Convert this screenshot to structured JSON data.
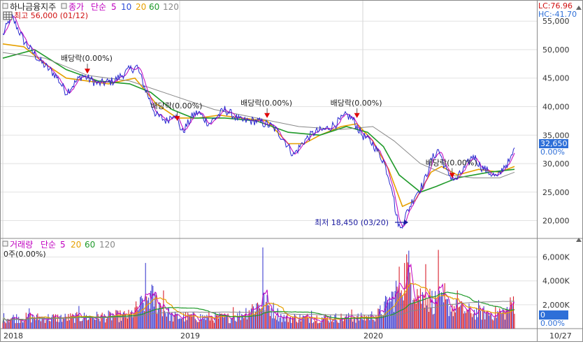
{
  "price_panel": {
    "legend": {
      "stock_name": "하나금융지주",
      "price_label": "종가",
      "ma_label": "단순",
      "periods": [
        "5",
        "10",
        "20",
        "60",
        "120"
      ]
    },
    "high_label": "최고 56,000 (01/12)",
    "low_label": "최저 18,450 (03/20)",
    "lc_label": "LC:76.96",
    "hc_label": "HC:-41.70",
    "current_price": "32,650",
    "current_change": "0.00%"
  },
  "volume_panel": {
    "legend": {
      "name": "거래량",
      "ma_label": "단순",
      "periods": [
        "5",
        "20",
        "60",
        "120"
      ]
    },
    "sub_label": "0주(0.00%)",
    "current_value": "0",
    "current_change": "0.00%"
  },
  "x_axis": {
    "labels": [
      "2018",
      "2019",
      "2020",
      "10/27"
    ]
  },
  "colors": {
    "price_line": "#2a2ad0",
    "ma5": "#c000c0",
    "ma10": "#2b4bd8",
    "ma20": "#e6a000",
    "ma60": "#1f9a2a",
    "ma120": "#888888",
    "dividend_marker": "#e00000",
    "volume_up": "#d8202c",
    "volume_down": "#3e3ed0",
    "accent_blue": "#2e6fd8"
  },
  "chart_data": [
    {
      "type": "line",
      "title": "하나금융지주",
      "x_unit": "trading days from 2018-01-02",
      "y_axis": {
        "range": [
          17000,
          56500
        ],
        "ticks": [
          "20,000",
          "25,000",
          "30,000",
          "35,000",
          "40,000",
          "45,000",
          "50,000",
          "55,000"
        ]
      },
      "x_axis_labels": [
        "2018",
        "2019",
        "2020",
        "10/27"
      ],
      "series": [
        {
          "name": "종가",
          "points": [
            [
              0,
              52500
            ],
            [
              8,
              56000
            ],
            [
              20,
              51500
            ],
            [
              35,
              48000
            ],
            [
              50,
              45500
            ],
            [
              60,
              42500
            ],
            [
              75,
              45500
            ],
            [
              90,
              44000
            ],
            [
              105,
              44500
            ],
            [
              120,
              46500
            ],
            [
              127,
              47000
            ],
            [
              135,
              43000
            ],
            [
              145,
              38500
            ],
            [
              155,
              37500
            ],
            [
              162,
              39000
            ],
            [
              170,
              35500
            ],
            [
              180,
              38500
            ],
            [
              185,
              39000
            ],
            [
              195,
              37000
            ],
            [
              210,
              39500
            ],
            [
              225,
              37500
            ],
            [
              240,
              37500
            ],
            [
              255,
              36500
            ],
            [
              265,
              34500
            ],
            [
              275,
              31500
            ],
            [
              285,
              34000
            ],
            [
              295,
              35500
            ],
            [
              305,
              36000
            ],
            [
              315,
              37000
            ],
            [
              325,
              38500
            ],
            [
              330,
              38000
            ],
            [
              340,
              35000
            ],
            [
              350,
              33500
            ],
            [
              360,
              30500
            ],
            [
              368,
              26000
            ],
            [
              372,
              21000
            ],
            [
              376,
              18450
            ],
            [
              380,
              20500
            ],
            [
              390,
              24500
            ],
            [
              398,
              26500
            ],
            [
              405,
              30500
            ],
            [
              412,
              32500
            ],
            [
              420,
              28500
            ],
            [
              428,
              27000
            ],
            [
              438,
              29500
            ],
            [
              445,
              31500
            ],
            [
              452,
              29500
            ],
            [
              460,
              28500
            ],
            [
              468,
              27500
            ],
            [
              474,
              29500
            ],
            [
              480,
              30500
            ],
            [
              484,
              32650
            ]
          ]
        },
        {
          "name": "20",
          "points": [
            [
              0,
              51000
            ],
            [
              20,
              50500
            ],
            [
              40,
              47500
            ],
            [
              60,
              45000
            ],
            [
              80,
              44500
            ],
            [
              100,
              44000
            ],
            [
              125,
              45000
            ],
            [
              145,
              40500
            ],
            [
              165,
              38000
            ],
            [
              185,
              38000
            ],
            [
              205,
              38500
            ],
            [
              225,
              38000
            ],
            [
              250,
              37500
            ],
            [
              270,
              33500
            ],
            [
              285,
              33500
            ],
            [
              300,
              35000
            ],
            [
              320,
              36500
            ],
            [
              335,
              37000
            ],
            [
              350,
              34000
            ],
            [
              365,
              29000
            ],
            [
              378,
              22500
            ],
            [
              390,
              23500
            ],
            [
              405,
              28500
            ],
            [
              415,
              29500
            ],
            [
              430,
              28000
            ],
            [
              450,
              29000
            ],
            [
              470,
              28500
            ],
            [
              484,
              29500
            ]
          ]
        },
        {
          "name": "60",
          "points": [
            [
              0,
              48500
            ],
            [
              30,
              50000
            ],
            [
              60,
              46500
            ],
            [
              90,
              44500
            ],
            [
              120,
              44000
            ],
            [
              140,
              42500
            ],
            [
              160,
              39500
            ],
            [
              180,
              38000
            ],
            [
              210,
              38000
            ],
            [
              240,
              37500
            ],
            [
              270,
              35500
            ],
            [
              300,
              35000
            ],
            [
              325,
              36500
            ],
            [
              345,
              35500
            ],
            [
              360,
              33000
            ],
            [
              375,
              28000
            ],
            [
              395,
              25000
            ],
            [
              410,
              26000
            ],
            [
              430,
              27500
            ],
            [
              460,
              28500
            ],
            [
              484,
              29000
            ]
          ]
        },
        {
          "name": "120",
          "points": [
            [
              0,
              49500
            ],
            [
              40,
              48500
            ],
            [
              80,
              45500
            ],
            [
              120,
              44500
            ],
            [
              160,
              42000
            ],
            [
              200,
              39500
            ],
            [
              240,
              38000
            ],
            [
              280,
              36500
            ],
            [
              320,
              36000
            ],
            [
              350,
              36500
            ],
            [
              370,
              34000
            ],
            [
              395,
              30000
            ],
            [
              420,
              28000
            ],
            [
              445,
              27500
            ],
            [
              470,
              27500
            ],
            [
              484,
              28500
            ]
          ]
        }
      ],
      "annotations": [
        {
          "label": "최고 56,000 (01/12)",
          "x": 8,
          "y": 56000
        },
        {
          "label": "최저 18,450 (03/20)",
          "x": 376,
          "y": 18450
        },
        {
          "label": "배당락(0.00%)",
          "x": 80,
          "y": 45800
        },
        {
          "label": "배당락(0.00%)",
          "x": 165,
          "y": 37500
        },
        {
          "label": "배당락(0.00%)",
          "x": 250,
          "y": 38000
        },
        {
          "label": "배당락(0.00%)",
          "x": 335,
          "y": 38000
        },
        {
          "label": "배당락(0.00%)",
          "x": 425,
          "y": 27500
        }
      ],
      "current": {
        "value": 32650,
        "label": "32,650",
        "change": "0.00%"
      }
    },
    {
      "type": "bar",
      "title": "거래량",
      "x_unit": "trading days from 2018-01-02",
      "y_axis": {
        "range": [
          0,
          7500000
        ],
        "ticks": [
          "2,000K",
          "4,000K",
          "6,000K"
        ]
      },
      "volume_shape_points": [
        [
          0,
          1000000
        ],
        [
          60,
          1000000
        ],
        [
          120,
          1200000
        ],
        [
          140,
          3000000
        ],
        [
          160,
          1100000
        ],
        [
          220,
          1000000
        ],
        [
          246,
          2500000
        ],
        [
          265,
          1000000
        ],
        [
          340,
          1000000
        ],
        [
          355,
          1300000
        ],
        [
          370,
          3000000
        ],
        [
          382,
          5500000
        ],
        [
          395,
          3000000
        ],
        [
          415,
          2300000
        ],
        [
          440,
          1600000
        ],
        [
          460,
          1400000
        ],
        [
          475,
          1500000
        ],
        [
          484,
          2500000
        ]
      ],
      "spikes": [
        [
          25,
          1700000
        ],
        [
          72,
          1900000
        ],
        [
          135,
          5500000
        ],
        [
          138,
          2600000
        ],
        [
          152,
          3200000
        ],
        [
          218,
          1800000
        ],
        [
          246,
          6800000
        ],
        [
          260,
          1700000
        ],
        [
          292,
          1500000
        ],
        [
          330,
          1600000
        ],
        [
          365,
          2200000
        ],
        [
          380,
          5500000
        ],
        [
          385,
          4700000
        ],
        [
          400,
          5400000
        ],
        [
          412,
          6600000
        ],
        [
          418,
          3800000
        ],
        [
          430,
          3200000
        ],
        [
          450,
          2400000
        ],
        [
          470,
          1700000
        ],
        [
          483,
          2700000
        ]
      ],
      "current": {
        "value": 0,
        "label": "0",
        "change": "0.00%"
      }
    }
  ]
}
